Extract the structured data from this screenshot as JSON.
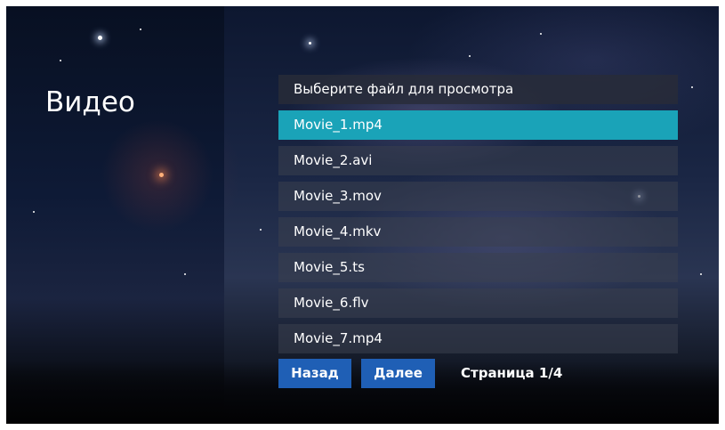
{
  "title": "Видео",
  "list": {
    "header": "Выберите файл для просмотра",
    "files": [
      {
        "name": "Movie_1.mp4",
        "selected": true
      },
      {
        "name": "Movie_2.avi",
        "selected": false
      },
      {
        "name": "Movie_3.mov",
        "selected": false
      },
      {
        "name": "Movie_4.mkv",
        "selected": false
      },
      {
        "name": "Movie_5.ts",
        "selected": false
      },
      {
        "name": "Movie_6.flv",
        "selected": false
      },
      {
        "name": "Movie_7.mp4",
        "selected": false
      }
    ]
  },
  "nav": {
    "back_label": "Назад",
    "next_label": "Далее",
    "page_info": "Страница 1/4"
  },
  "colors": {
    "selected_row": "#1aa3b8",
    "button": "#1f5fb5"
  }
}
